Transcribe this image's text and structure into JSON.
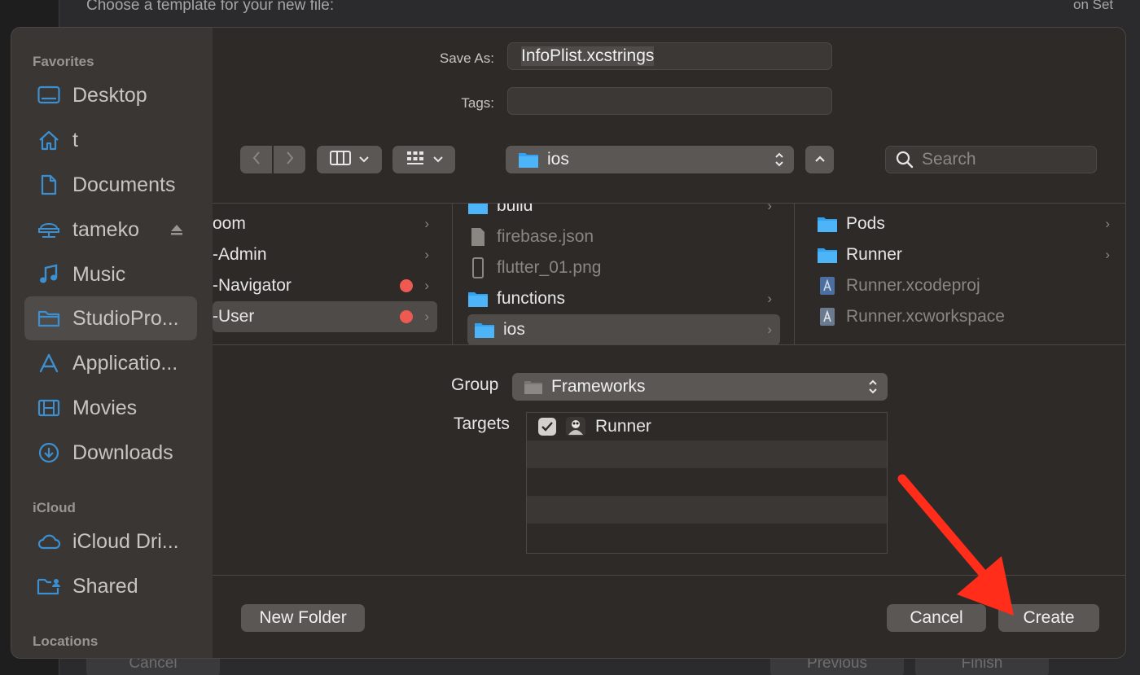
{
  "background": {
    "title": "Choose a template for your new file:",
    "right_text": "on Set",
    "buttons": [
      "Cancel",
      "Previous",
      "Finish"
    ]
  },
  "sidebar": {
    "sections": [
      {
        "label": "Favorites"
      },
      {
        "label": "iCloud"
      },
      {
        "label": "Locations"
      }
    ],
    "items": [
      {
        "label": "Desktop",
        "icon": "desktop-icon"
      },
      {
        "label": "t",
        "icon": "home-icon"
      },
      {
        "label": "Documents",
        "icon": "document-icon"
      },
      {
        "label": "tameko",
        "icon": "network-drive-icon"
      },
      {
        "label": "Music",
        "icon": "music-icon"
      },
      {
        "label": "StudioPro...",
        "icon": "folder-icon"
      },
      {
        "label": "Applicatio...",
        "icon": "applications-icon"
      },
      {
        "label": "Movies",
        "icon": "movies-icon"
      },
      {
        "label": "Downloads",
        "icon": "downloads-icon"
      },
      {
        "label": "iCloud Dri...",
        "icon": "cloud-icon"
      },
      {
        "label": "Shared",
        "icon": "shared-folder-icon"
      }
    ],
    "selected": "StudioPro..."
  },
  "save_as": {
    "label": "Save As:",
    "value": "InfoPlist.xcstrings"
  },
  "tags": {
    "label": "Tags:",
    "value": ""
  },
  "toolbar": {
    "path": "ios",
    "search_placeholder": "Search"
  },
  "columns": [
    {
      "rows": [
        {
          "label": "oom",
          "chevron": "›",
          "tag": false,
          "selected": false
        },
        {
          "label": "-Admin",
          "chevron": "›",
          "tag": false,
          "selected": false
        },
        {
          "label": "-Navigator",
          "chevron": "›",
          "tag": true,
          "selected": false
        },
        {
          "label": "-User",
          "chevron": "›",
          "tag": true,
          "selected": true
        }
      ]
    },
    {
      "rows": [
        {
          "label": "build",
          "type": "folder",
          "chevron": "›",
          "dim": false
        },
        {
          "label": "firebase.json",
          "type": "file",
          "chevron": "",
          "dim": true
        },
        {
          "label": "flutter_01.png",
          "type": "image",
          "chevron": "",
          "dim": true
        },
        {
          "label": "functions",
          "type": "folder",
          "chevron": "›",
          "dim": false
        },
        {
          "label": "ios",
          "type": "folder",
          "chevron": "›",
          "dim": false,
          "selected": true
        }
      ]
    },
    {
      "rows": [
        {
          "label": "Pods",
          "type": "folder",
          "chevron": "›",
          "dim": false
        },
        {
          "label": "Runner",
          "type": "folder",
          "chevron": "›",
          "dim": false
        },
        {
          "label": "Runner.xcodeproj",
          "type": "xcodeproj",
          "chevron": "",
          "dim": true
        },
        {
          "label": "Runner.xcworkspace",
          "type": "xcworkspace",
          "chevron": "",
          "dim": true
        }
      ]
    }
  ],
  "group": {
    "label": "Group",
    "value": "Frameworks"
  },
  "targets": {
    "label": "Targets",
    "items": [
      {
        "label": "Runner",
        "checked": true
      }
    ]
  },
  "buttons": {
    "new_folder": "New Folder",
    "cancel": "Cancel",
    "create": "Create"
  },
  "colors": {
    "accent_folder": "#2fa3f2",
    "tag_red": "#ee5a52",
    "annotation_arrow": "#ff2d1a"
  }
}
